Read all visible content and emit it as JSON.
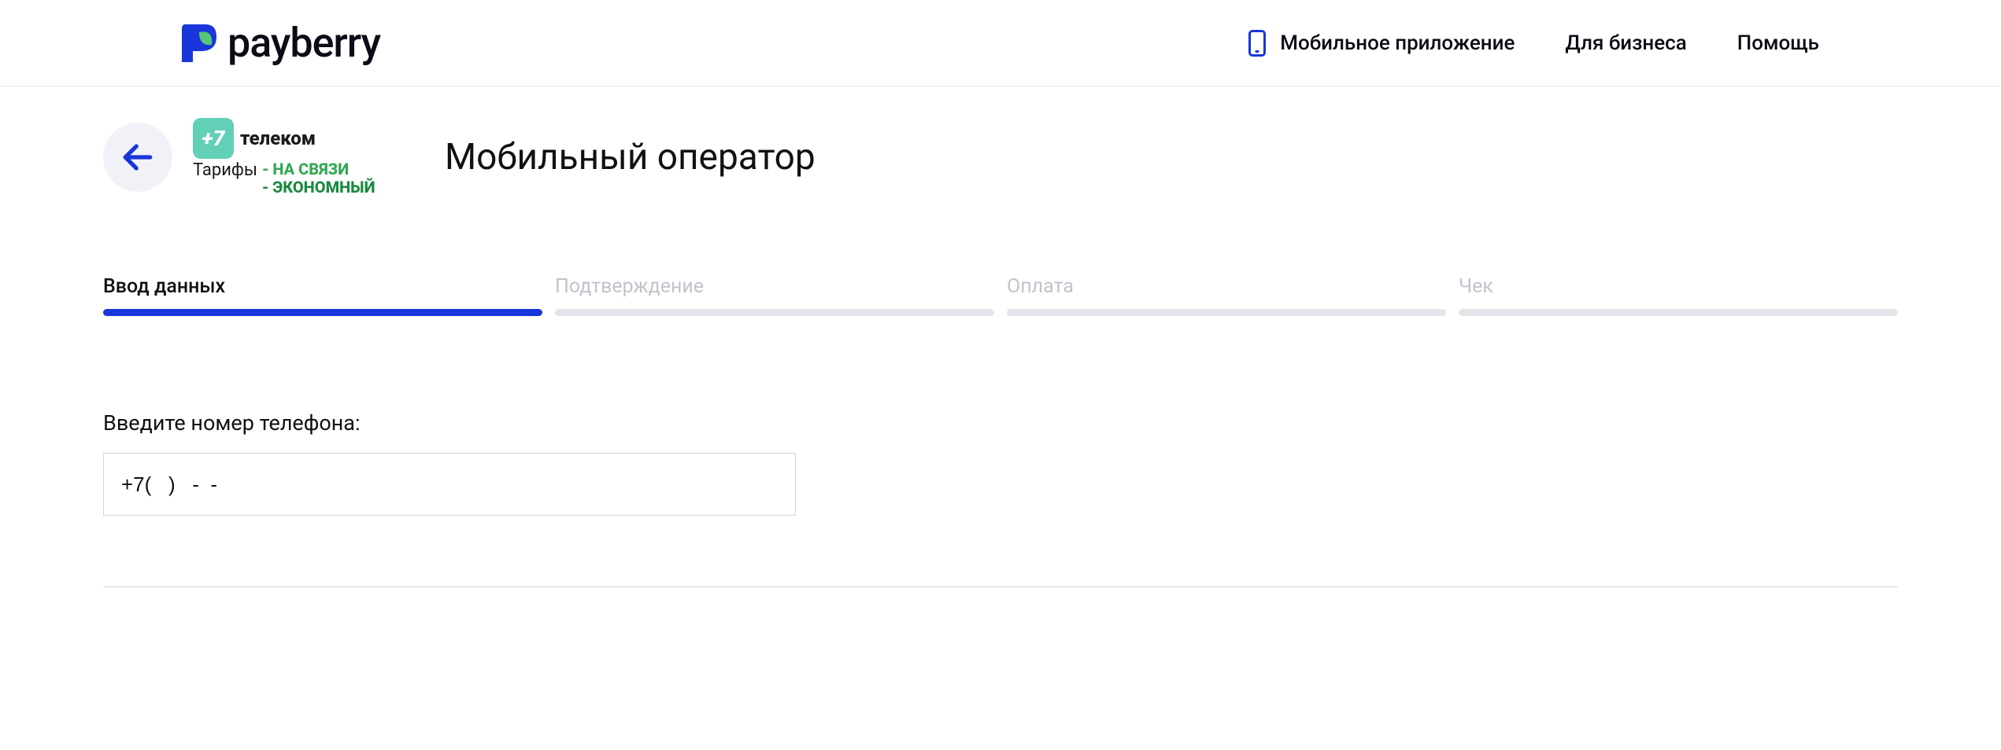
{
  "brand": {
    "name": "payberry"
  },
  "nav": {
    "mobile_app": "Мобильное приложение",
    "business": "Для бизнеса",
    "help": "Помощь"
  },
  "provider": {
    "badge": "+7",
    "name": "телеком",
    "tariffs_label": "Тарифы",
    "tag1": "- НА СВЯЗИ",
    "tag2": "- ЭКОНОМНЫЙ"
  },
  "page_title": "Мобильный оператор",
  "steps": [
    {
      "label": "Ввод данных",
      "active": true
    },
    {
      "label": "Подтверждение",
      "active": false
    },
    {
      "label": "Оплата",
      "active": false
    },
    {
      "label": "Чек",
      "active": false
    }
  ],
  "form": {
    "phone_label": "Введите номер телефона:",
    "phone_mask": "+7(   )   -  -"
  }
}
